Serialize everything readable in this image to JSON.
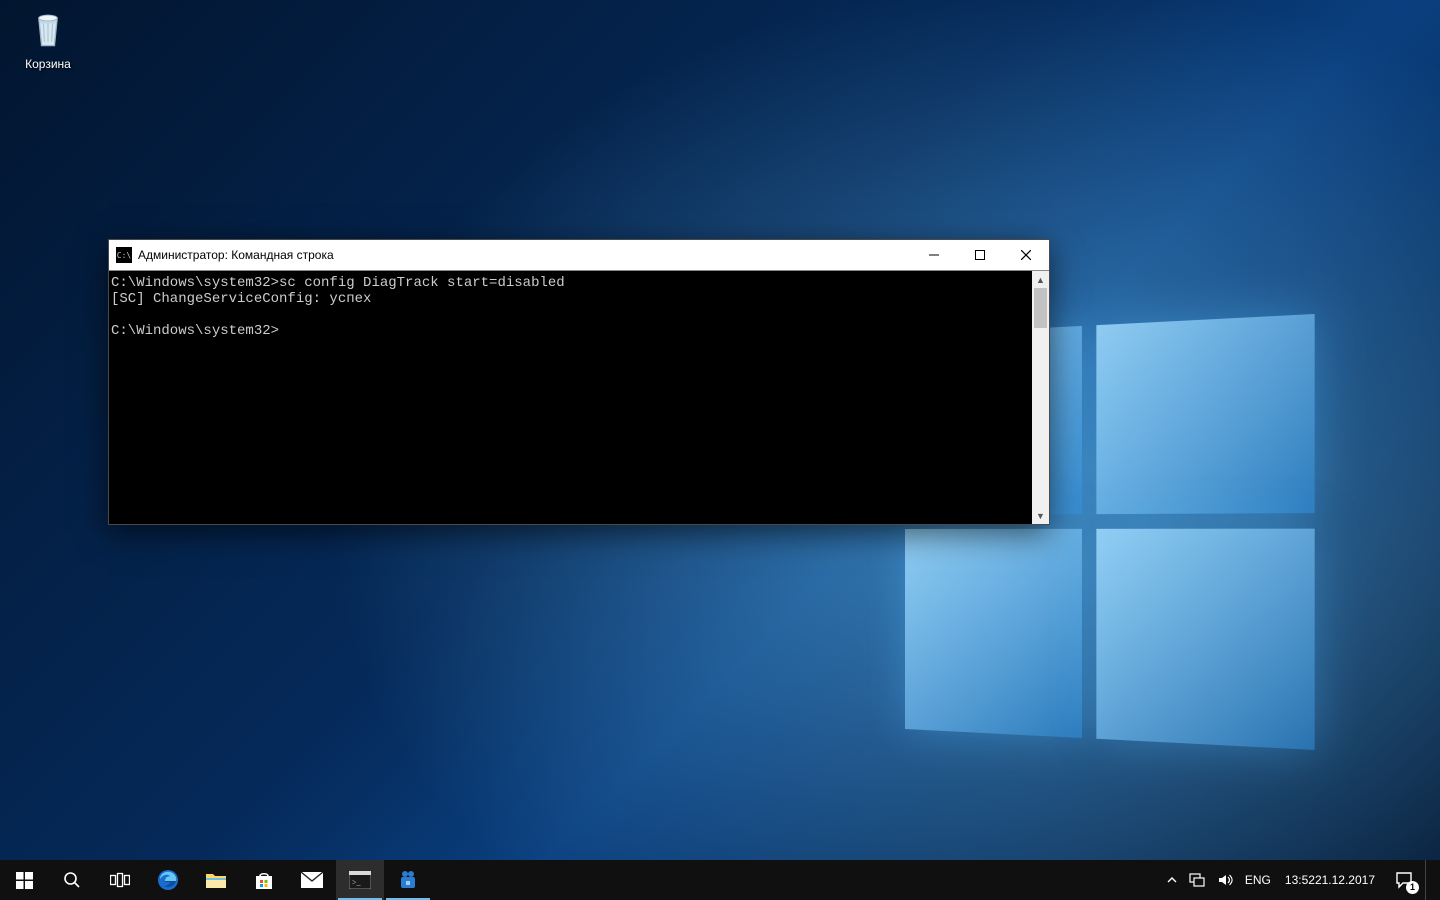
{
  "desktop": {
    "recycle_bin_label": "Корзина"
  },
  "cmd": {
    "title": "Администратор: Командная строка",
    "lines": [
      "C:\\Windows\\system32>sc config DiagTrack start=disabled",
      "[SC] ChangeServiceConfig: успех",
      "",
      "C:\\Windows\\system32>"
    ]
  },
  "tray": {
    "lang": "ENG",
    "time": "13:52",
    "date": "21.12.2017",
    "action_center_badge": "1"
  }
}
